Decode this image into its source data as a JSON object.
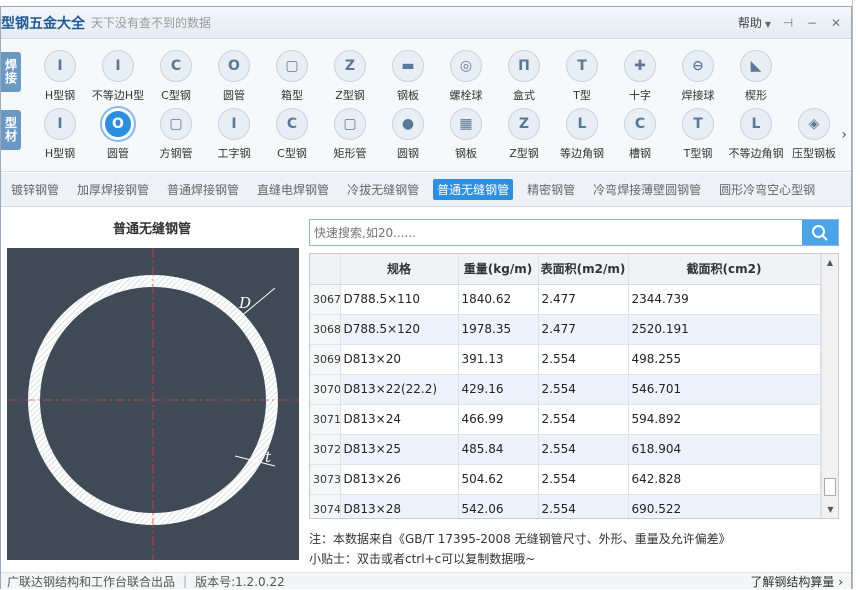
{
  "app": {
    "title": "型钢五金大全",
    "subtitle": "天下没有查不到的数据",
    "help_label": "帮助"
  },
  "icon_rows": [
    {
      "label_line1": "焊",
      "label_line2": "接",
      "items": [
        {
          "label": "H型钢",
          "glyph": "I"
        },
        {
          "label": "不等边H型",
          "glyph": "I"
        },
        {
          "label": "C型钢",
          "glyph": "C"
        },
        {
          "label": "圆管",
          "glyph": "O"
        },
        {
          "label": "箱型",
          "glyph": "▢"
        },
        {
          "label": "Z型钢",
          "glyph": "Z"
        },
        {
          "label": "钢板",
          "glyph": "▬"
        },
        {
          "label": "螺栓球",
          "glyph": "◎"
        },
        {
          "label": "盒式",
          "glyph": "Π"
        },
        {
          "label": "T型",
          "glyph": "T"
        },
        {
          "label": "十字",
          "glyph": "✚"
        },
        {
          "label": "焊接球",
          "glyph": "⊖"
        },
        {
          "label": "楔形",
          "glyph": "◣"
        }
      ]
    },
    {
      "label_line1": "型",
      "label_line2": "材",
      "items": [
        {
          "label": "H型钢",
          "glyph": "I"
        },
        {
          "label": "圆管",
          "glyph": "O",
          "selected": true
        },
        {
          "label": "方钢管",
          "glyph": "▢"
        },
        {
          "label": "工字钢",
          "glyph": "I"
        },
        {
          "label": "C型钢",
          "glyph": "C"
        },
        {
          "label": "矩形管",
          "glyph": "▢"
        },
        {
          "label": "圆钢",
          "glyph": "●"
        },
        {
          "label": "钢板",
          "glyph": "▦"
        },
        {
          "label": "Z型钢",
          "glyph": "Z"
        },
        {
          "label": "等边角钢",
          "glyph": "L"
        },
        {
          "label": "槽钢",
          "glyph": "C"
        },
        {
          "label": "T型钢",
          "glyph": "T"
        },
        {
          "label": "不等边角钢",
          "glyph": "L"
        },
        {
          "label": "压型钢板",
          "glyph": "◈"
        }
      ]
    }
  ],
  "tabs": [
    {
      "label": "镀锌钢管"
    },
    {
      "label": "加厚焊接钢管"
    },
    {
      "label": "普通焊接钢管"
    },
    {
      "label": "直缝电焊钢管"
    },
    {
      "label": "冷拔无缝钢管"
    },
    {
      "label": "普通无缝钢管",
      "active": true
    },
    {
      "label": "精密钢管"
    },
    {
      "label": "冷弯焊接薄壁圆钢管"
    },
    {
      "label": "圆形冷弯空心型钢"
    }
  ],
  "left_panel": {
    "title": "普通无缝钢管",
    "diagram_labels": {
      "d": "D",
      "t": "t"
    }
  },
  "search": {
    "placeholder": "快速搜索,如20......"
  },
  "table": {
    "headers": [
      "",
      "规格",
      "重量(kg/m)",
      "表面积(m2/m)",
      "截面积(cm2)"
    ],
    "rows": [
      [
        "3067",
        "D788.5×110",
        "1840.62",
        "2.477",
        "2344.739"
      ],
      [
        "3068",
        "D788.5×120",
        "1978.35",
        "2.477",
        "2520.191"
      ],
      [
        "3069",
        "D813×20",
        "391.13",
        "2.554",
        "498.255"
      ],
      [
        "3070",
        "D813×22(22.2)",
        "429.16",
        "2.554",
        "546.701"
      ],
      [
        "3071",
        "D813×24",
        "466.99",
        "2.554",
        "594.892"
      ],
      [
        "3072",
        "D813×25",
        "485.84",
        "2.554",
        "618.904"
      ],
      [
        "3073",
        "D813×26",
        "504.62",
        "2.554",
        "642.828"
      ],
      [
        "3074",
        "D813×28",
        "542.06",
        "2.554",
        "690.522"
      ]
    ]
  },
  "notes": {
    "note": "注：本数据来自《GB/T  17395-2008  无缝钢管尺寸、外形、重量及允许偏差》",
    "tip": "小贴士：双击或者ctrl+c可以复制数据哦~"
  },
  "status": {
    "producer": "广联达钢结构和工作台联合出品",
    "version": "版本号:1.2.0.22",
    "link": "了解钢结构算量"
  }
}
